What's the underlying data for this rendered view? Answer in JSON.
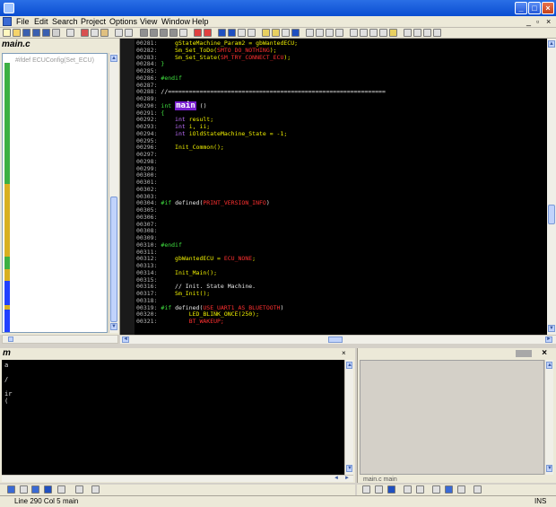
{
  "window": {
    "minimize_glyph": "_",
    "maximize_glyph": "□",
    "close_glyph": "×"
  },
  "menu": {
    "items": [
      "File",
      "Edit",
      "Search",
      "Project",
      "Options",
      "View",
      "Window",
      "Help"
    ],
    "mdi_controls": [
      "_",
      "▫",
      "×"
    ]
  },
  "left_panel": {
    "title": "main.c",
    "first_item": "#ifdef ECUConfig(Set_ECU)",
    "tree_marks": [
      "green",
      "green",
      "green",
      "green",
      "green",
      "green",
      "green",
      "green",
      "green",
      "green",
      "green",
      "green",
      "green",
      "green",
      "green",
      "green",
      "green",
      "green",
      "green",
      "green",
      "green",
      "green",
      "green",
      "green",
      "green",
      "green",
      "green",
      "green",
      "green",
      "green",
      "yellow",
      "yellow",
      "yellow",
      "yellow",
      "yellow",
      "yellow",
      "yellow",
      "yellow",
      "yellow",
      "yellow",
      "yellow",
      "yellow",
      "yellow",
      "yellow",
      "yellow",
      "yellow",
      "yellow",
      "yellow",
      "green",
      "green",
      "green",
      "yellow",
      "yellow",
      "yellow",
      "blue",
      "blue",
      "blue",
      "blue",
      "blue",
      "blue",
      "yellow",
      "blue",
      "blue",
      "blue",
      "blue",
      "blue",
      "blue",
      "blue"
    ]
  },
  "editor": {
    "lines": [
      {
        "num": "00281:",
        "segments": [
          {
            "t": "    gStateMachine_Param2 = gbWantedECU;",
            "c": "yellow"
          }
        ]
      },
      {
        "num": "00282:",
        "segments": [
          {
            "t": "    Sm_Set_ToDo(",
            "c": "yellow"
          },
          {
            "t": "SMTO_DO_NOTHING",
            "c": "red"
          },
          {
            "t": ");",
            "c": "yellow"
          }
        ]
      },
      {
        "num": "00283:",
        "segments": [
          {
            "t": "    Sm_Set_State(",
            "c": "yellow"
          },
          {
            "t": "SM_TRY_CONNECT_ECU",
            "c": "red"
          },
          {
            "t": ");",
            "c": "yellow"
          }
        ]
      },
      {
        "num": "00284:",
        "segments": [
          {
            "t": "}",
            "c": "green"
          }
        ]
      },
      {
        "num": "00285:",
        "segments": []
      },
      {
        "num": "00286:",
        "segments": [
          {
            "t": "#endif",
            "c": "green"
          }
        ]
      },
      {
        "num": "00287:",
        "segments": []
      },
      {
        "num": "00288:",
        "segments": [
          {
            "t": "//==============================================================",
            "c": "default"
          }
        ]
      },
      {
        "num": "00289:",
        "segments": []
      },
      {
        "num": "00290:",
        "segments": [
          {
            "t": "int ",
            "c": "green"
          },
          {
            "t": "main",
            "c": "main"
          },
          {
            "t": " ()",
            "c": "default"
          }
        ]
      },
      {
        "num": "00291:",
        "segments": [
          {
            "t": "{",
            "c": "green"
          }
        ]
      },
      {
        "num": "00292:",
        "segments": [
          {
            "t": "    int ",
            "c": "violet"
          },
          {
            "t": "result;",
            "c": "yellow"
          }
        ]
      },
      {
        "num": "00293:",
        "segments": [
          {
            "t": "    int ",
            "c": "violet"
          },
          {
            "t": "i, ii;",
            "c": "yellow"
          }
        ]
      },
      {
        "num": "00294:",
        "segments": [
          {
            "t": "    int ",
            "c": "violet"
          },
          {
            "t": "iOldStateMachine_State = -1;",
            "c": "yellow"
          }
        ]
      },
      {
        "num": "00295:",
        "segments": []
      },
      {
        "num": "00296:",
        "segments": [
          {
            "t": "    Init_Common();",
            "c": "yellow"
          }
        ]
      },
      {
        "num": "00297:",
        "segments": []
      },
      {
        "num": "00298:",
        "segments": []
      },
      {
        "num": "00299:",
        "segments": []
      },
      {
        "num": "00300:",
        "segments": []
      },
      {
        "num": "00301:",
        "segments": []
      },
      {
        "num": "00302:",
        "segments": []
      },
      {
        "num": "00303:",
        "segments": []
      },
      {
        "num": "00304:",
        "segments": [
          {
            "t": "#if ",
            "c": "green"
          },
          {
            "t": "defined(",
            "c": "default"
          },
          {
            "t": "PRINT_VERSION_INFO",
            "c": "red"
          },
          {
            "t": ")",
            "c": "default"
          }
        ]
      },
      {
        "num": "00305:",
        "segments": []
      },
      {
        "num": "00306:",
        "segments": []
      },
      {
        "num": "00307:",
        "segments": []
      },
      {
        "num": "00308:",
        "segments": []
      },
      {
        "num": "00309:",
        "segments": []
      },
      {
        "num": "00310:",
        "segments": [
          {
            "t": "#endif",
            "c": "green"
          }
        ]
      },
      {
        "num": "00311:",
        "segments": []
      },
      {
        "num": "00312:",
        "segments": [
          {
            "t": "    gbWantedECU = ",
            "c": "yellow"
          },
          {
            "t": "ECU_NONE",
            "c": "red"
          },
          {
            "t": ";",
            "c": "yellow"
          }
        ]
      },
      {
        "num": "00313:",
        "segments": []
      },
      {
        "num": "00314:",
        "segments": [
          {
            "t": "    Init_Main();",
            "c": "yellow"
          }
        ]
      },
      {
        "num": "00315:",
        "segments": []
      },
      {
        "num": "00316:",
        "segments": [
          {
            "t": "    // Init. State Machine.",
            "c": "default"
          }
        ]
      },
      {
        "num": "00317:",
        "segments": [
          {
            "t": "    Sm_Init();",
            "c": "yellow"
          }
        ]
      },
      {
        "num": "00318:",
        "segments": []
      },
      {
        "num": "00319:",
        "segments": [
          {
            "t": "#if ",
            "c": "green"
          },
          {
            "t": "defined(",
            "c": "default"
          },
          {
            "t": "USE_UART1_AS_BLUETOOTH",
            "c": "red"
          },
          {
            "t": ")",
            "c": "default"
          }
        ]
      },
      {
        "num": "00320:",
        "segments": [
          {
            "t": "        LED_BLINK_ONCE(250);",
            "c": "yellow"
          }
        ]
      },
      {
        "num": "00321:",
        "segments": [
          {
            "t": "        BT_WAKEUP;",
            "c": "red"
          }
        ]
      }
    ]
  },
  "bottom_left": {
    "title": "m",
    "lines": [
      "a",
      "/",
      "ir",
      "("
    ]
  },
  "bottom_right": {
    "tab_label": "main.c  main"
  },
  "statusbar": {
    "position": "Line 290  Col 5",
    "function": "main",
    "mode": "INS"
  },
  "colors": {
    "yellow": "#f0f000",
    "green": "#40e040",
    "red": "#ff3030",
    "violet": "#c070ff",
    "blue": "#2040ff",
    "main_highlight": "#7a1fd0"
  }
}
